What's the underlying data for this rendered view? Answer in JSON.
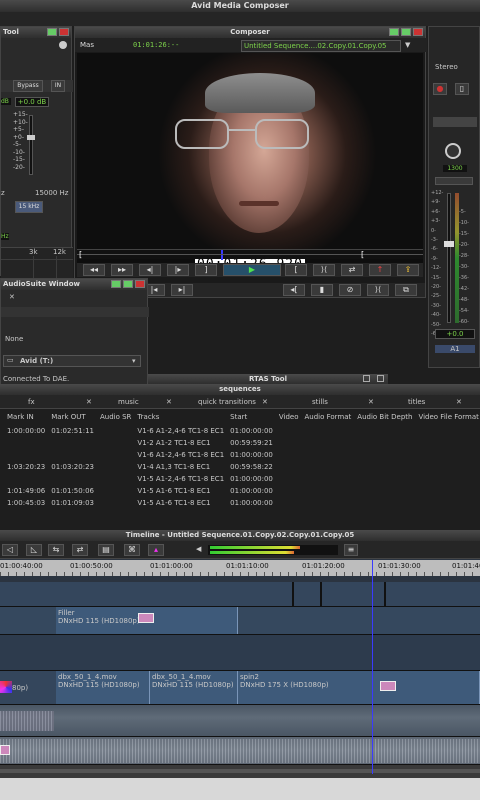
{
  "app": {
    "title": "Avid Media Composer"
  },
  "audio_tool": {
    "title": "Tool",
    "bypass_label": "Bypass",
    "in_label": "IN",
    "gain_left": "dB",
    "gain_right": "+0.0 dB",
    "scale": [
      "+15-",
      "+10-",
      "+5-",
      "+0-",
      "-5-",
      "-10-",
      "-15-",
      "-20-"
    ],
    "freq_low": "z",
    "freq_high": "15000 Hz",
    "khz_button": "15 kHz",
    "hz_label": "Hz",
    "axis_3k": "3k",
    "axis_12k": "12k"
  },
  "composer": {
    "title": "Composer",
    "mas_label": "Mas",
    "timecode_top": "01:01:26:--",
    "sequence_name": "Untitled Sequence....02.Copy.01.Copy.05",
    "timecode_overlay": "00:01:26.920"
  },
  "audiosuite": {
    "title": "AudioSuite Window",
    "option_none": "None",
    "avid_drive": "Avid (T:)",
    "connected": "Connected To DAE."
  },
  "mixer": {
    "stereo_label": "Stereo",
    "value_1300": "1300",
    "gain_value": "+0.0",
    "track_label": "A1",
    "scale_left": [
      "+12-",
      "+9-",
      "+6-",
      "+3-",
      "0-",
      "-3-",
      "-6-",
      "-9-",
      "-12-",
      "-15-",
      "-20-",
      "-25-",
      "-30-",
      "-40-",
      "-50-",
      "-60-"
    ],
    "scale_right": [
      "-5-",
      "-10-",
      "-15-",
      "-20-",
      "-28-",
      "-30-",
      "-36-",
      "-42-",
      "-48-",
      "-54-",
      "-60-"
    ]
  },
  "rtas_tool": {
    "title": "RTAS Tool"
  },
  "sequences": {
    "title": "sequences",
    "tabs": [
      "fx",
      "music",
      "quick transitions",
      "stills",
      "titles"
    ],
    "columns": [
      "Mark IN",
      "Mark OUT",
      "Audio SR",
      "Tracks",
      "Start",
      "Video",
      "Audio Format",
      "Audio Bit Depth",
      "Video File Format"
    ],
    "rows": [
      {
        "mark_in": "1:00:00:00",
        "mark_out": "01:02:51:11",
        "tracks": "V1-6 A1-2,4-6 TC1-8 EC1",
        "start": "01:00:00:00"
      },
      {
        "mark_in": "",
        "mark_out": "",
        "tracks": "V1-2 A1-2 TC1-8 EC1",
        "start": "00:59:59:21"
      },
      {
        "mark_in": "",
        "mark_out": "",
        "tracks": "V1-6 A1-2,4-6 TC1-8 EC1",
        "start": "01:00:00:00"
      },
      {
        "mark_in": "1:03:20:23",
        "mark_out": "01:03:20:23",
        "tracks": "V1-4 A1,3 TC1-8 EC1",
        "start": "00:59:58:22"
      },
      {
        "mark_in": "",
        "mark_out": "",
        "tracks": "V1-5 A1-2,4-6 TC1-8 EC1",
        "start": "01:00:00:00"
      },
      {
        "mark_in": "1:01:49:06",
        "mark_out": "01:01:50:06",
        "tracks": "V1-5 A1-6 TC1-8 EC1",
        "start": "01:00:00:00"
      },
      {
        "mark_in": "1:00:45:03",
        "mark_out": "01:01:09:03",
        "tracks": "V1-5 A1-6 TC1-8 EC1",
        "start": "01:00:00:00"
      }
    ]
  },
  "timeline": {
    "title": "Timeline - Untitled Sequence.01.Copy.02.Copy.01.Copy.05",
    "ruler": [
      "01:00:40:00",
      "01:00:50:00",
      "01:01:00:00",
      "01:01:10:00",
      "01:01:20:00",
      "01:01:30:00",
      "01:01:40"
    ],
    "filler_name": "Filler",
    "filler_fmt": "DNxHD 115 (HD1080p)",
    "clip1_name": "dbx_50_1_4.mov",
    "clip1_fmt": "DNxHD 115 (HD1080p)",
    "clip2_name": "dbx_50_1_4.mov",
    "clip2_fmt": "DNxHD 115 (HD1080p)",
    "clip3_name": "spin2",
    "clip3_fmt": "DNxHD 175 X (HD1080p)",
    "left_label": "80p)"
  },
  "colors": {
    "accent_green": "#7dd34b",
    "playhead": "#3a3aff",
    "clip": "#3e5a7a"
  }
}
